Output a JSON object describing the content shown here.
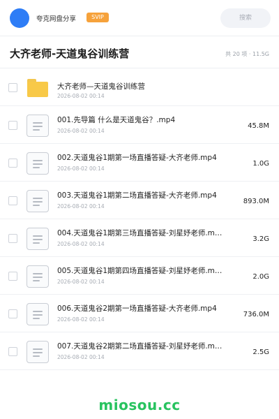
{
  "header": {
    "brand": "夸克网盘分享",
    "badge": "SVIP",
    "search_label": "搜索"
  },
  "folder": {
    "title": "大齐老师-天道鬼谷训练营",
    "meta": "共 20 项 · 11.5G"
  },
  "files": [
    {
      "name": "大齐老师—天道鬼谷训练营",
      "date": "2026-08-02 00:14",
      "size": "",
      "type": "folder"
    },
    {
      "name": "001.先导篇 什么是天道鬼谷？.mp4",
      "date": "2026-08-02 00:14",
      "size": "45.8M",
      "type": "video"
    },
    {
      "name": "002.天道鬼谷1期第一场直播答疑-大齐老师.mp4",
      "date": "2026-08-02 00:14",
      "size": "1.0G",
      "type": "video"
    },
    {
      "name": "003.天道鬼谷1期第二场直播答疑-大齐老师.mp4",
      "date": "2026-08-02 00:14",
      "size": "893.0M",
      "type": "video"
    },
    {
      "name": "004.天道鬼谷1期第三场直播答疑-刘星妤老师.m…",
      "date": "2026-08-02 00:14",
      "size": "3.2G",
      "type": "video"
    },
    {
      "name": "005.天道鬼谷1期第四场直播答疑-刘星妤老师.m…",
      "date": "2026-08-02 00:14",
      "size": "2.0G",
      "type": "video"
    },
    {
      "name": "006.天道鬼谷2期第一场直播答疑-大齐老师.mp4",
      "date": "2026-08-02 00:14",
      "size": "736.0M",
      "type": "video"
    },
    {
      "name": "007.天道鬼谷2期第二场直播答疑-刘星妤老师.m…",
      "date": "2026-08-02 00:14",
      "size": "2.5G",
      "type": "video"
    }
  ],
  "footer": {
    "watermark": "miosou.cc"
  },
  "colors": {
    "avatar": "#2e7df6",
    "badge": "#f6a23b",
    "folder_icon": "#f8c948",
    "watermark": "#28c35f"
  }
}
